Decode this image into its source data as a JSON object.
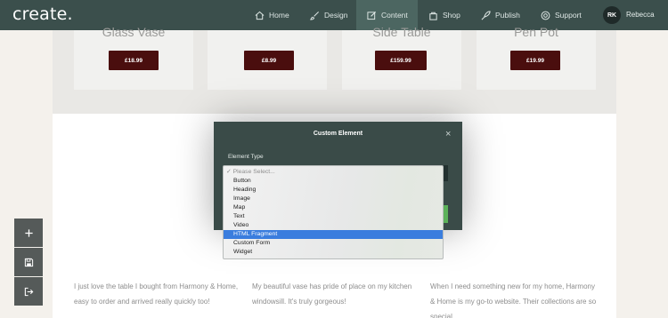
{
  "nav": {
    "logo": "create.",
    "items": [
      {
        "label": "Home",
        "icon": "home-icon"
      },
      {
        "label": "Design",
        "icon": "brush-icon"
      },
      {
        "label": "Content",
        "icon": "edit-icon"
      },
      {
        "label": "Shop",
        "icon": "bag-icon"
      },
      {
        "label": "Publish",
        "icon": "rocket-icon"
      },
      {
        "label": "Support",
        "icon": "lifebuoy-icon"
      }
    ],
    "active": "Content",
    "user_initials": "RK",
    "user_name": "Rebecca"
  },
  "products": [
    {
      "title": "Glass Vase",
      "price": "£18.99"
    },
    {
      "title": "",
      "price": "£8.99"
    },
    {
      "title": "Side Table",
      "price": "£159.99"
    },
    {
      "title": "Pen Pot",
      "price": "£19.99"
    }
  ],
  "testimonials": [
    "I just love the table I bought from Harmony & Home, easy to order and arrived really quickly too!",
    "My beautiful vase has pride of place on my kitchen windowsill. It's truly gorgeous!",
    "When I need something new for my home, Harmony & Home is my go-to website. Their collections are so special."
  ],
  "modal": {
    "title": "Custom Element",
    "close": "×",
    "field_label": "Element Type",
    "placeholder": "✓ Please Select...",
    "options": [
      "Button",
      "Heading",
      "Image",
      "Map",
      "Text",
      "Video",
      "HTML Fragment",
      "Custom Form",
      "Widget"
    ],
    "highlighted": "HTML Fragment"
  },
  "tools": [
    "add-icon",
    "save-icon",
    "exit-icon"
  ],
  "colors": {
    "nav_bg": "#3b4f4c",
    "price_button": "#4a0e0e",
    "modal_bg": "#3a4b48",
    "highlight": "#3a7dde",
    "accent_green": "#5cb25a"
  }
}
